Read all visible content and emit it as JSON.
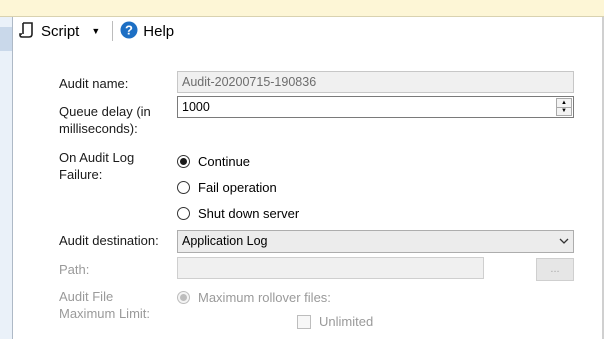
{
  "toolbar": {
    "script_label": "Script",
    "help_label": "Help",
    "icons": {
      "script": "script-icon",
      "dropdown": "chevron-down-icon",
      "help": "help-icon"
    }
  },
  "form": {
    "audit_name": {
      "label": "Audit name:",
      "value": "Audit-20200715-190836"
    },
    "queue_delay": {
      "label_line1": "Queue delay (in",
      "label_line2": "milliseconds):",
      "value": "1000"
    },
    "on_failure": {
      "label_line1": "On Audit Log",
      "label_line2": "Failure:",
      "options": [
        "Continue",
        "Fail operation",
        "Shut down server"
      ],
      "selected": "Continue"
    },
    "audit_destination": {
      "label": "Audit destination:",
      "value": "Application Log"
    },
    "path": {
      "label": "Path:",
      "value": "",
      "browse_label": "..."
    },
    "file_limit": {
      "label_line1": "Audit File",
      "label_line2": "Maximum Limit:",
      "rollover_label": "Maximum rollover files:",
      "unlimited_label": "Unlimited"
    }
  },
  "colors": {
    "help_blue": "#1d6fc4",
    "info_bar": "#fdf6d6",
    "disabled_text": "#9a9a9a"
  }
}
